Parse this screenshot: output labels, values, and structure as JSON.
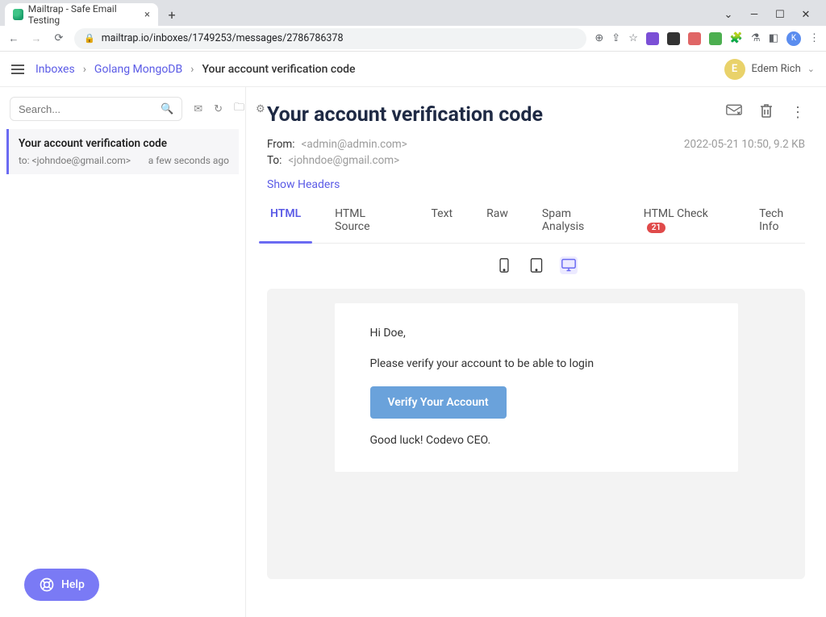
{
  "browser": {
    "tab_title": "Mailtrap - Safe Email Testing",
    "url": "mailtrap.io/inboxes/1749253/messages/2786786378"
  },
  "header": {
    "crumb_inboxes": "Inboxes",
    "crumb_project": "Golang MongoDB",
    "crumb_current": "Your account verification code",
    "user_initial": "E",
    "user_name": "Edem Rich"
  },
  "sidebar": {
    "search_placeholder": "Search...",
    "help_label": "Help",
    "messages": [
      {
        "subject": "Your account verification code",
        "to": "to: <johndoe@gmail.com>",
        "time": "a few seconds ago"
      }
    ]
  },
  "message": {
    "title": "Your account verification code",
    "from_label": "From:",
    "from_value": "<admin@admin.com>",
    "to_label": "To:",
    "to_value": "<johndoe@gmail.com>",
    "timestamp": "2022-05-21 10:50, 9.2 KB",
    "show_headers": "Show Headers"
  },
  "tabs": {
    "html": "HTML",
    "html_source": "HTML Source",
    "text": "Text",
    "raw": "Raw",
    "spam": "Spam Analysis",
    "html_check": "HTML Check",
    "html_check_badge": "21",
    "tech": "Tech Info"
  },
  "email_body": {
    "greeting": "Hi Doe,",
    "line1": "Please verify your account to be able to login",
    "cta": "Verify Your Account",
    "signoff": "Good luck! Codevo CEO."
  }
}
